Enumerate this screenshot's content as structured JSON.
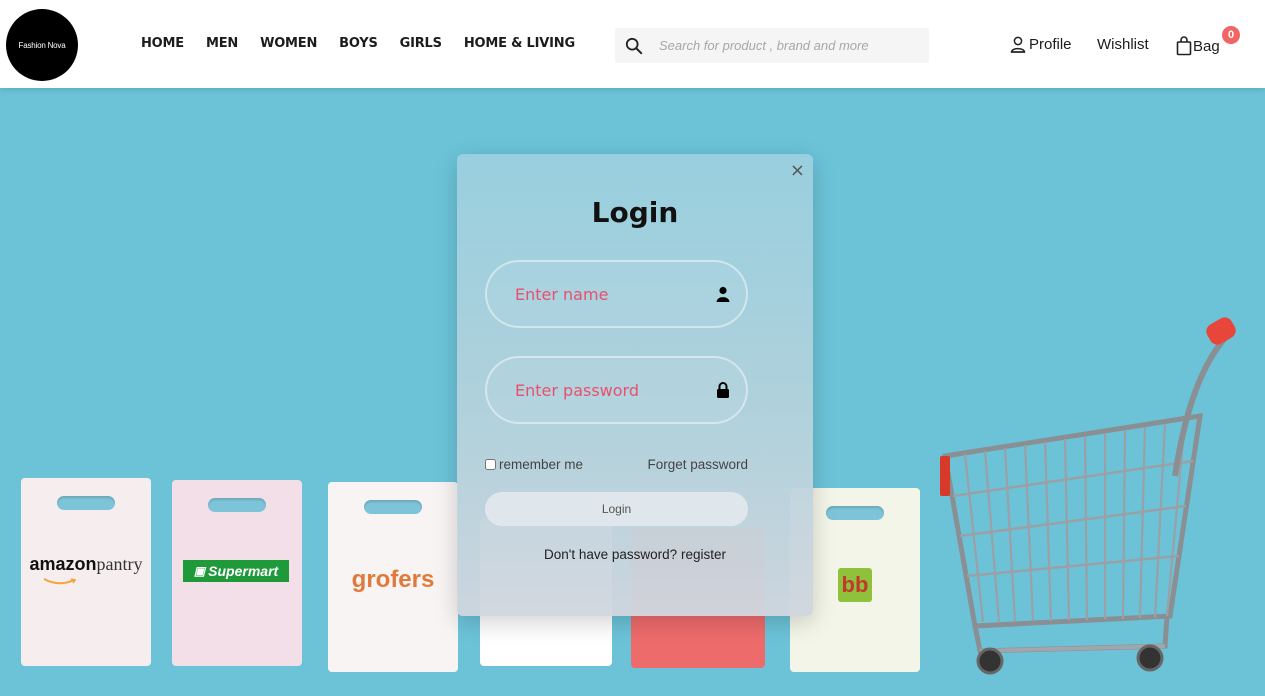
{
  "header": {
    "logo_text": "Fashion Nova",
    "nav": [
      "HOME",
      "MEN",
      "WOMEN",
      "BOYS",
      "GIRLS",
      "HOME & LIVING"
    ],
    "search": {
      "placeholder": "Search for product , brand and more",
      "value": ""
    },
    "profile_label": "Profile",
    "wishlist_label": "Wishlist",
    "bag_label": "Bag",
    "bag_count": "0"
  },
  "hero": {
    "background_color": "#6cc3d8",
    "bags": [
      {
        "brand": "amazonpantry",
        "brand_part1": "amazon",
        "brand_part2": "pantry"
      },
      {
        "brand": "Supermart"
      },
      {
        "brand": "grofers"
      },
      {
        "brand": "bb"
      }
    ]
  },
  "login_modal": {
    "title": "Login",
    "close_symbol": "×",
    "name_placeholder": "Enter name",
    "password_placeholder": "Enter password",
    "remember_label": "remember me",
    "remember_checked": false,
    "forget_label": "Forget password",
    "login_button": "Login",
    "register_prompt": "Don't have password?",
    "register_link": "register",
    "accent_color": "#e8506e"
  }
}
